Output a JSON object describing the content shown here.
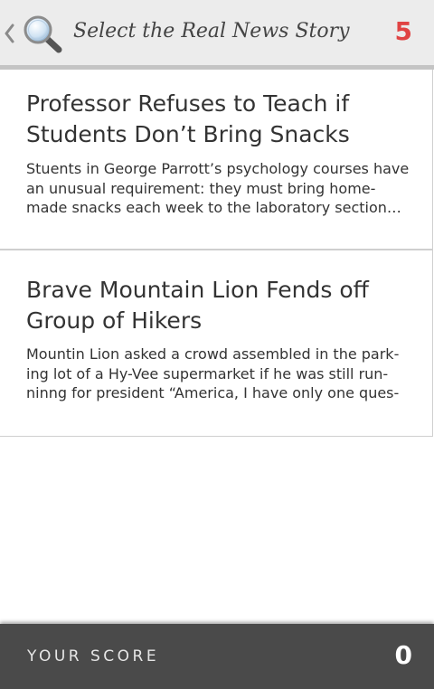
{
  "header": {
    "title": "Select the Real News Story",
    "count": "5",
    "back_icon": "chevron-left-icon",
    "search_icon": "magnifier-icon"
  },
  "stories": [
    {
      "headline": "Professor Refuses to Teach if Students Don’t Bring Snacks",
      "snippet": "Stuents in George Parrott’s psychology courses have an unusual requirement: they must bring home-made snacks each week to the laboratory section…"
    },
    {
      "headline": "Brave Mountain Lion Fends off Group of Hikers",
      "snippet": "Mountin Lion asked a crowd assembled in the park-ing lot of a Hy-Vee supermarket if he was still run-ninng for president “America, I have only one ques-"
    }
  ],
  "footer": {
    "score_label": "YOUR SCORE",
    "score_value": "0"
  },
  "colors": {
    "accent": "#e04444",
    "footer_bg": "#4a4a4a",
    "header_bg": "#ececec"
  }
}
